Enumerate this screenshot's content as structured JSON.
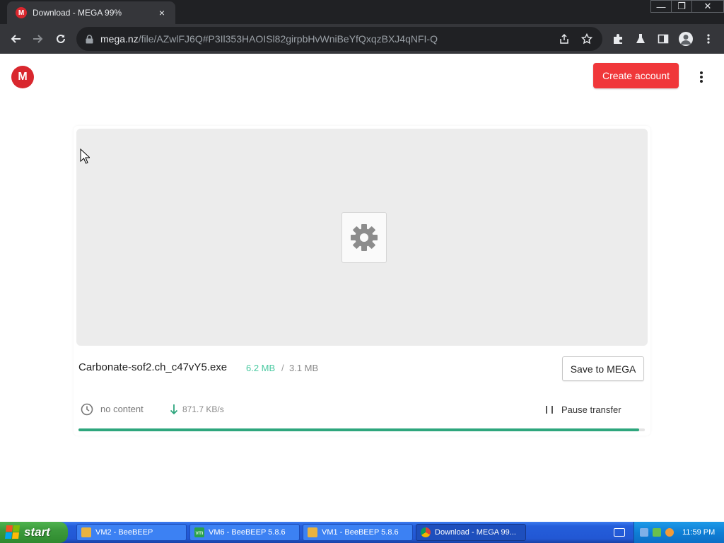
{
  "browser": {
    "tab_title": "Download - MEGA 99%",
    "tab_favicon": "M",
    "tab_close": "×",
    "url_host": "mega.nz",
    "url_path": "/file/AZwlFJ6Q#P3Il353HAOISl82girpbHvWniBeYfQxqzBXJ4qNFI-Q",
    "window_controls": {
      "minimize": "—",
      "restore": "❐",
      "close": "✕"
    }
  },
  "page": {
    "logo_letter": "M",
    "create_account_label": "Create account",
    "file": {
      "name": "Carbonate-sof2.ch_c47vY5.exe",
      "downloaded": "6.2 MB",
      "separator": "/",
      "total": "3.1 MB"
    },
    "save_to_mega_label": "Save to MEGA",
    "status": {
      "time_remaining": "no content",
      "speed": "871.7 KB/s",
      "pause_label": "Pause transfer",
      "progress_percent": 99
    }
  },
  "taskbar": {
    "start_label": "start",
    "tasks": [
      {
        "label": "VM2 - BeeBEEP",
        "icon": "beebeep-folder-icon"
      },
      {
        "label": "VM6 - BeeBEEP 5.8.6",
        "icon": "vm-icon"
      },
      {
        "label": "VM1 - BeeBEEP 5.8.6",
        "icon": "beebeep-folder-icon"
      },
      {
        "label": "Download - MEGA 99...",
        "icon": "chrome-icon"
      }
    ],
    "clock": "11:59 PM"
  },
  "colors": {
    "mega_red": "#d9272e",
    "create_button": "#f0373a",
    "progress": "#2ea67d",
    "downloaded_size": "#48c9a0"
  }
}
